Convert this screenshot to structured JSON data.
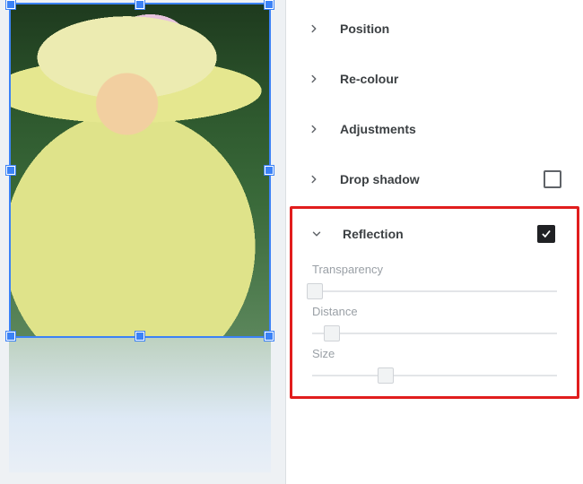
{
  "canvas": {
    "selected_object": "image"
  },
  "panel": {
    "sections": {
      "position": {
        "label": "Position",
        "expanded": false
      },
      "recolour": {
        "label": "Re-colour",
        "expanded": false
      },
      "adjustments": {
        "label": "Adjustments",
        "expanded": false
      },
      "dropshadow": {
        "label": "Drop shadow",
        "expanded": false,
        "enabled": false
      },
      "reflection": {
        "label": "Reflection",
        "expanded": true,
        "enabled": true
      }
    },
    "reflection_controls": {
      "transparency": {
        "label": "Transparency",
        "value": 0,
        "min": 0,
        "max": 100
      },
      "distance": {
        "label": "Distance",
        "value": 8,
        "min": 0,
        "max": 100
      },
      "size": {
        "label": "Size",
        "value": 30,
        "min": 0,
        "max": 100
      }
    }
  },
  "colors": {
    "selection": "#3b82f6",
    "highlight_box": "#e11d1d",
    "label_muted": "#9aa0a6"
  }
}
